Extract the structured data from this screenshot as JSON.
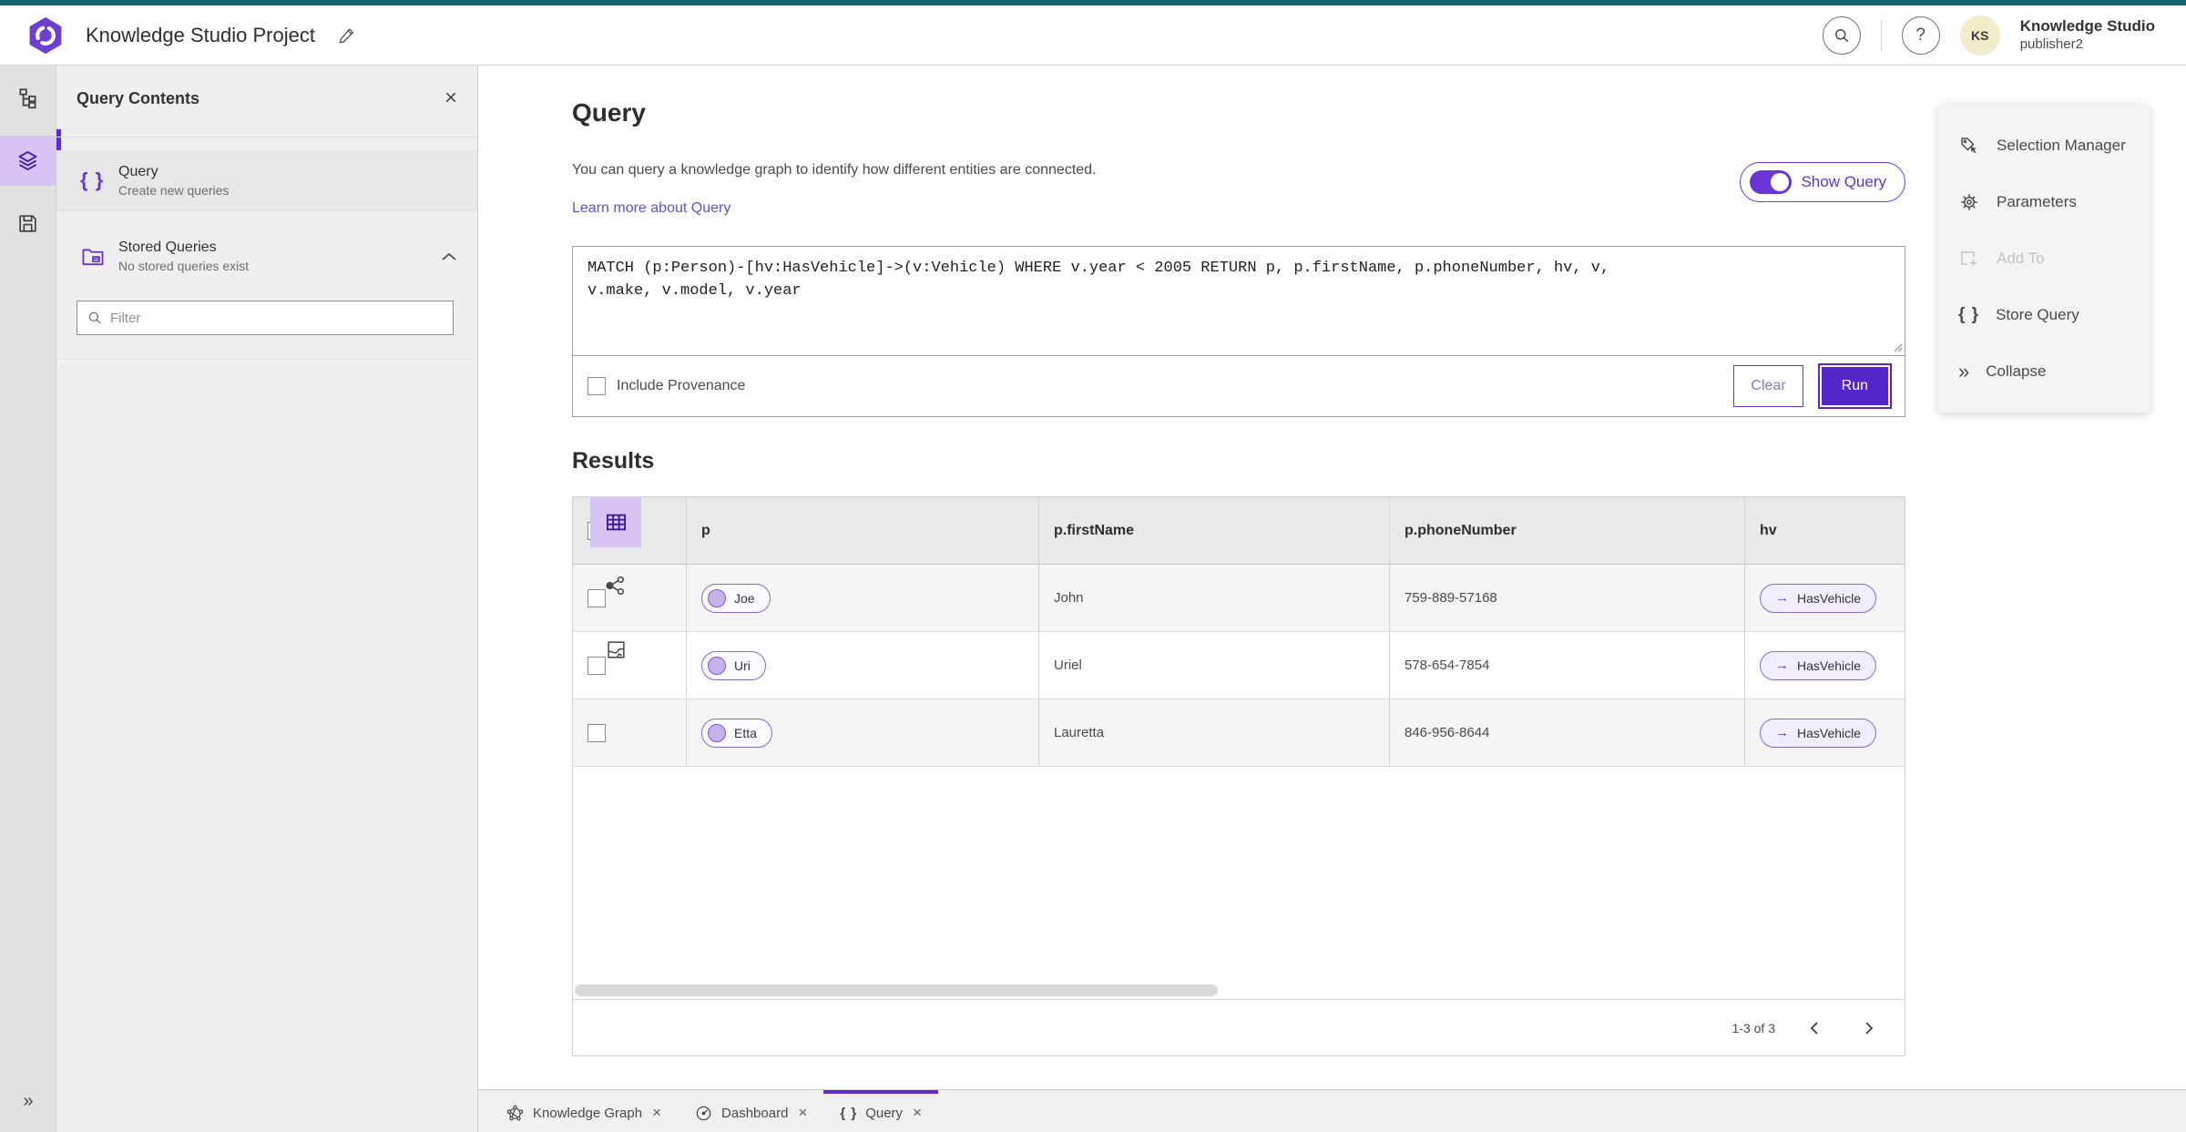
{
  "colors": {
    "accent_purple": "#5e2ccf",
    "accent_purple_light": "#d7c4f5",
    "top_strip_teal": "#156570",
    "link_purple": "#6352cc",
    "avatar_bg": "#f1ecca",
    "run_button_bg": "#5226c9"
  },
  "header": {
    "project_title": "Knowledge Studio Project",
    "account_name": "Knowledge Studio",
    "account_user": "publisher2",
    "avatar_initials": "KS",
    "help_glyph": "?"
  },
  "icons": {
    "braces": "{ }",
    "collapse": "»",
    "expand": "»",
    "close": "×",
    "arrow_right": "→"
  },
  "contents_panel": {
    "title": "Query Contents",
    "items": [
      {
        "title": "Query",
        "subtitle": "Create new queries"
      },
      {
        "title": "Stored Queries",
        "subtitle": "No stored queries exist"
      }
    ],
    "filter_placeholder": "Filter"
  },
  "query_section": {
    "heading": "Query",
    "description": "You can query a knowledge graph to identify how different entities are connected.",
    "learn_more_label": "Learn more about Query",
    "show_query_label": "Show Query",
    "query_text": "MATCH (p:Person)-[hv:HasVehicle]->(v:Vehicle) WHERE v.year < 2005 RETURN p, p.firstName, p.phoneNumber, hv, v,\nv.make, v.model, v.year",
    "include_provenance_label": "Include Provenance",
    "clear_label": "Clear",
    "run_label": "Run"
  },
  "results": {
    "heading": "Results",
    "columns": [
      "p",
      "p.firstName",
      "p.phoneNumber",
      "hv"
    ],
    "rows": [
      {
        "p": "Joe",
        "firstName": "John",
        "phoneNumber": "759-889-57168",
        "hv": "HasVehicle"
      },
      {
        "p": "Uri",
        "firstName": "Uriel",
        "phoneNumber": "578-654-7854",
        "hv": "HasVehicle"
      },
      {
        "p": "Etta",
        "firstName": "Lauretta",
        "phoneNumber": "846-956-8644",
        "hv": "HasVehicle"
      }
    ],
    "pagination_label": "1-3 of 3"
  },
  "tools_panel": {
    "items": [
      {
        "label": "Selection Manager"
      },
      {
        "label": "Parameters"
      },
      {
        "label": "Add To"
      },
      {
        "label": "Store Query"
      },
      {
        "label": "Collapse"
      }
    ]
  },
  "tabs": [
    {
      "label": "Knowledge Graph"
    },
    {
      "label": "Dashboard"
    },
    {
      "label": "Query"
    }
  ]
}
